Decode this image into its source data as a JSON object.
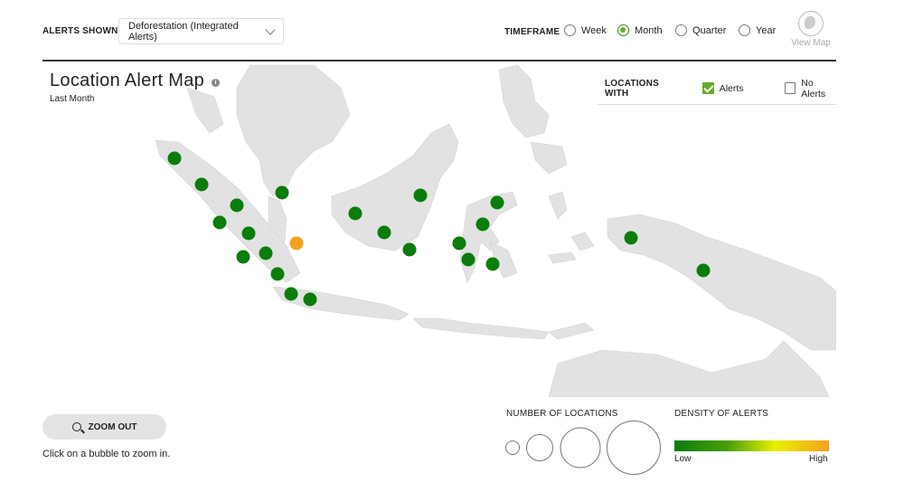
{
  "header": {
    "alerts_shown_label": "ALERTS SHOWN",
    "alerts_dropdown_value": "Deforestation (Integrated Alerts)",
    "timeframe_label": "TIMEFRAME",
    "timeframe_options": [
      {
        "label": "Week",
        "selected": false
      },
      {
        "label": "Month",
        "selected": true
      },
      {
        "label": "Quarter",
        "selected": false
      },
      {
        "label": "Year",
        "selected": false
      }
    ],
    "view_map_label": "View Map"
  },
  "map": {
    "title": "Location Alert Map",
    "info_glyph": "i",
    "subtitle": "Last Month",
    "locations_with_label": "LOCATIONS WITH",
    "filters": [
      {
        "label": "Alerts",
        "checked": true
      },
      {
        "label": "No Alerts",
        "checked": false
      }
    ],
    "bubbles": [
      {
        "density": "low"
      },
      {
        "density": "low"
      },
      {
        "density": "low"
      },
      {
        "density": "low"
      },
      {
        "density": "low"
      },
      {
        "density": "low"
      },
      {
        "density": "low"
      },
      {
        "density": "low"
      },
      {
        "density": "low"
      },
      {
        "density": "low"
      },
      {
        "density": "low"
      },
      {
        "density": "high"
      },
      {
        "density": "low"
      },
      {
        "density": "low"
      },
      {
        "density": "low"
      },
      {
        "density": "low"
      },
      {
        "density": "low"
      },
      {
        "density": "low"
      },
      {
        "density": "low"
      },
      {
        "density": "low"
      },
      {
        "density": "low"
      },
      {
        "density": "low"
      },
      {
        "density": "low"
      },
      {
        "density": "low"
      }
    ]
  },
  "footer": {
    "zoom_out_label": "ZOOM OUT",
    "hint": "Click on a bubble to zoom in.",
    "number_of_locations_label": "NUMBER OF LOCATIONS",
    "density_label": "DENSITY OF ALERTS",
    "density_low": "Low",
    "density_high": "High"
  },
  "colors": {
    "low": "#0a7d0a",
    "high": "#f6a11b",
    "accent": "#6aaa2a",
    "land": "#e2e2e2"
  }
}
